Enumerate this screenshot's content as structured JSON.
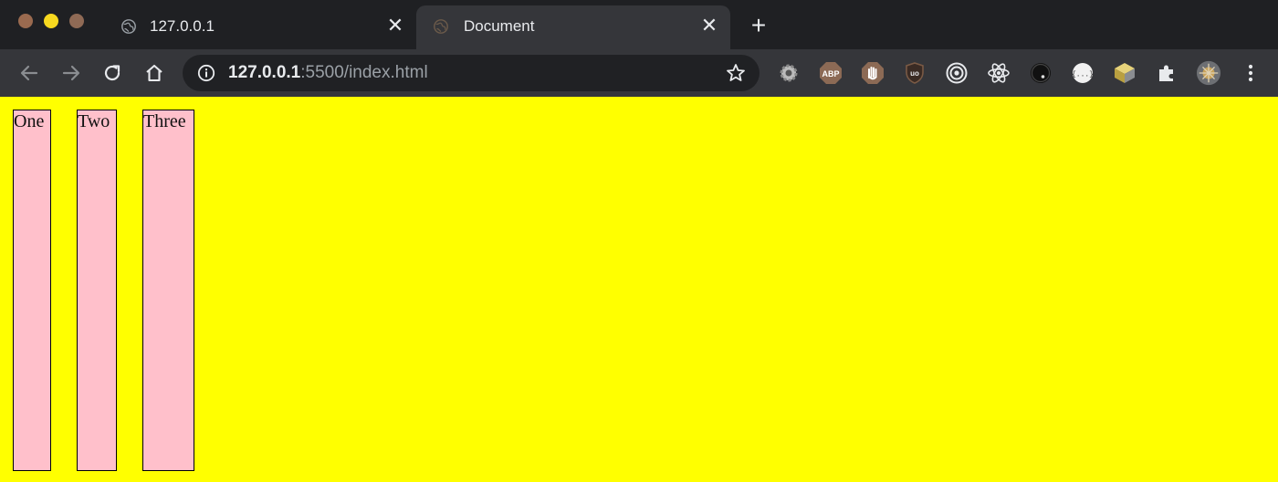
{
  "colors": {
    "chrome_dark": "#1f2023",
    "tab_active": "#35363a",
    "toolbar": "#35363a",
    "omnibox": "#202124",
    "text_light": "#e8eaed",
    "text_dim": "#9aa0a6",
    "page_background": "#ffff00",
    "box_fill": "#ffc0cb",
    "traffic_red": "#9a6a4f",
    "traffic_yellow": "#f7d81f",
    "traffic_green": "#8f6a55"
  },
  "tabs": [
    {
      "title": "127.0.0.1",
      "favicon": "globe-icon",
      "active": false
    },
    {
      "title": "Document",
      "favicon": "globe-icon",
      "active": true
    }
  ],
  "tab_close_glyph": "✕",
  "new_tab_glyph": "+",
  "address_bar": {
    "url_host": "127.0.0.1",
    "url_rest": ":5500/index.html"
  },
  "extensions": [
    "gear-extension-icon",
    "adblock-plus-icon",
    "hand-stop-icon",
    "ublock-origin-icon",
    "target-icon",
    "react-devtools-icon",
    "dark-circle-icon",
    "json-viewer-icon",
    "cube-extension-icon",
    "puzzle-extensions-icon",
    "profile-avatar",
    "kebab-menu-icon"
  ],
  "extension_labels": {
    "abp": "ABP",
    "ublock": "uo",
    "json": "{...}"
  },
  "page": {
    "boxes": [
      "One",
      "Two",
      "Three"
    ]
  }
}
